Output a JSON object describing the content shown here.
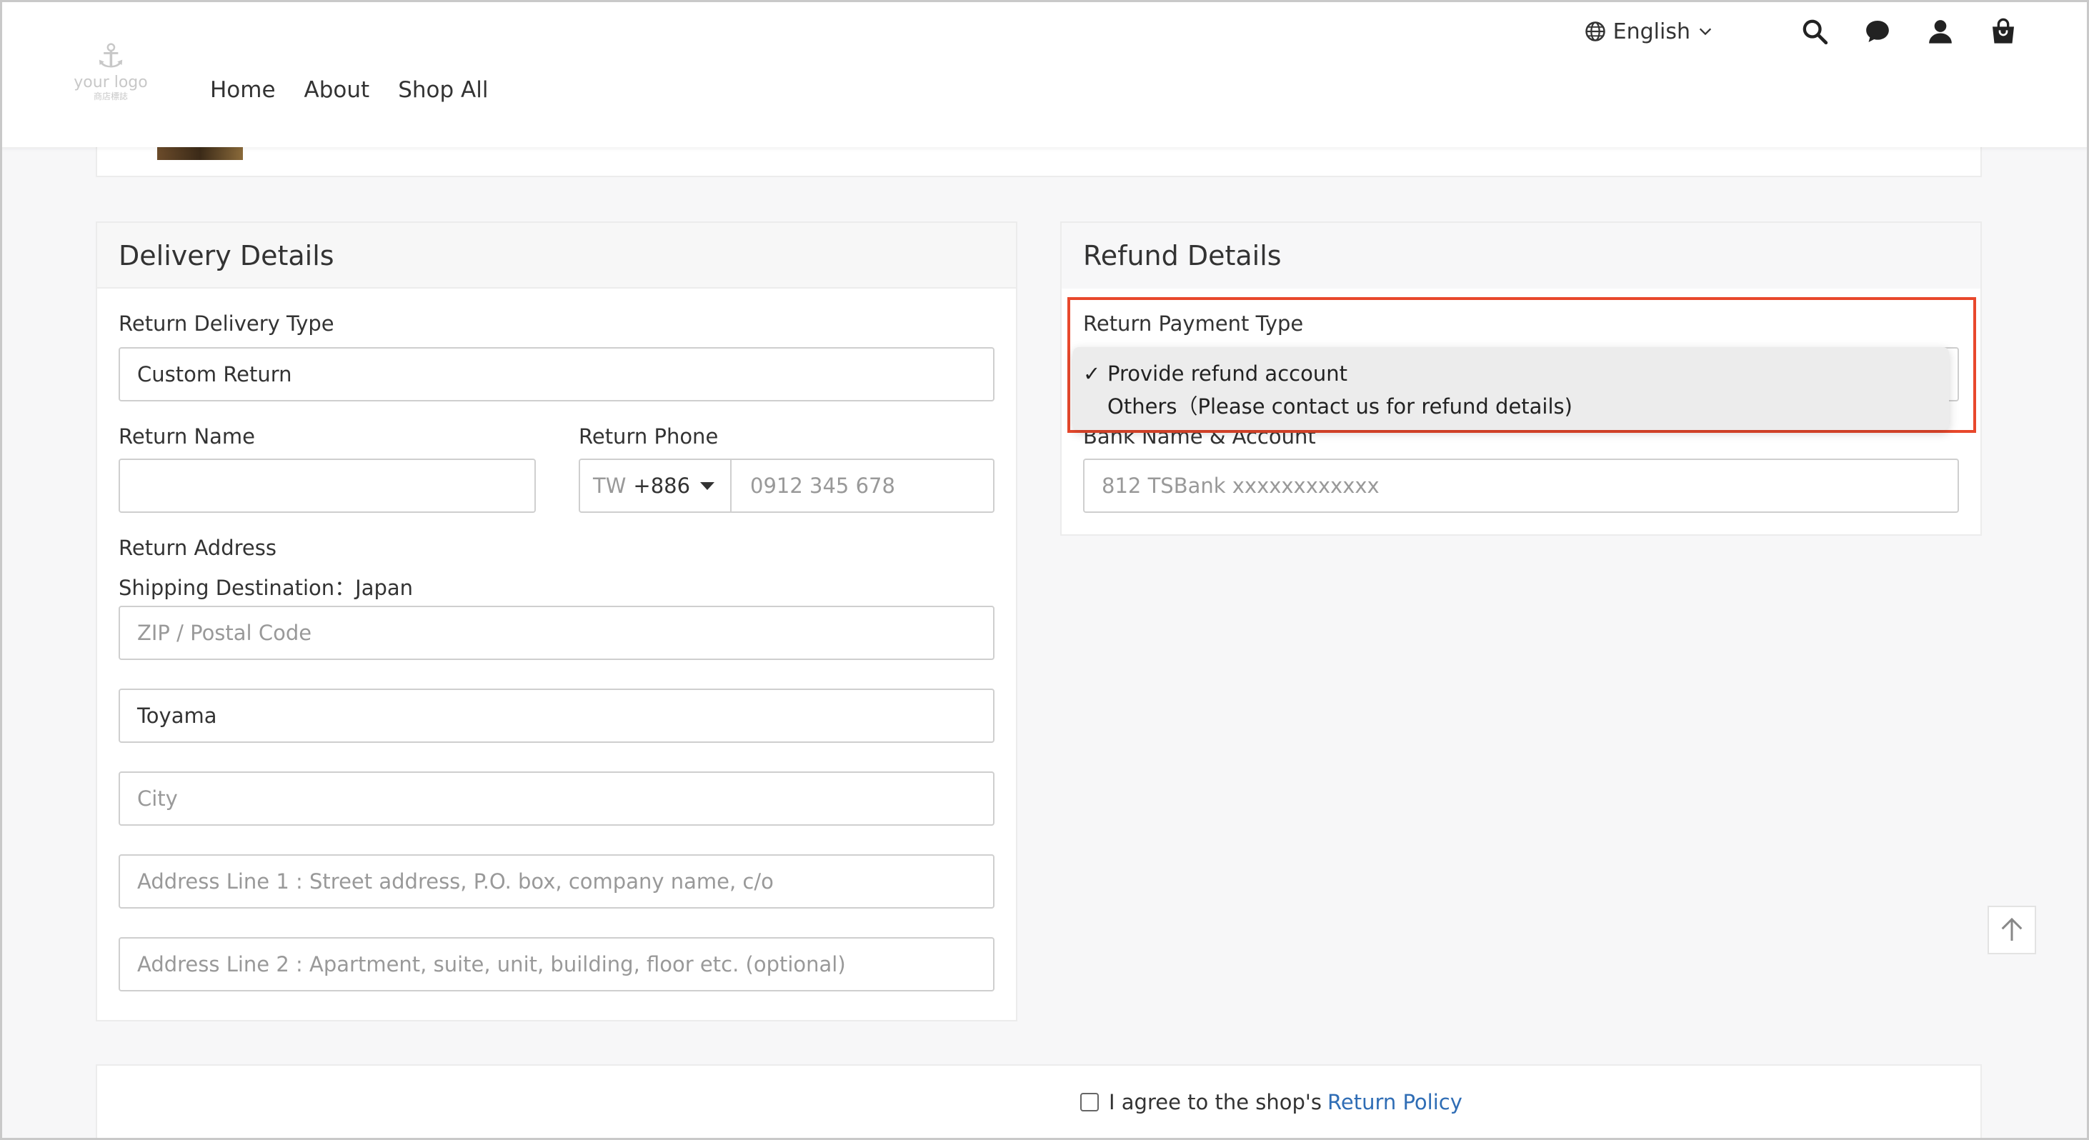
{
  "header": {
    "logo_text": "your logo",
    "logo_sub": "商店標誌",
    "nav": [
      "Home",
      "About",
      "Shop All"
    ],
    "language": "English"
  },
  "delivery": {
    "title": "Delivery Details",
    "return_delivery_type_label": "Return Delivery Type",
    "return_delivery_type_value": "Custom Return",
    "return_name_label": "Return Name",
    "return_name_value": "",
    "return_phone_label": "Return Phone",
    "phone_country": "TW",
    "phone_code": "+886",
    "phone_placeholder": "0912 345 678",
    "return_address_label": "Return Address",
    "shipping_destination": "Shipping Destination：Japan",
    "zip_placeholder": "ZIP / Postal Code",
    "prefecture_value": "Toyama",
    "city_placeholder": "City",
    "address1_placeholder": "Address Line 1 : Street address, P.O. box, company name, c/o",
    "address2_placeholder": "Address Line 2 : Apartment, suite, unit, building, floor etc. (optional)"
  },
  "refund": {
    "title": "Refund Details",
    "payment_type_label": "Return Payment Type",
    "options": [
      {
        "label": "Provide refund account",
        "selected": true
      },
      {
        "label": "Others（Please contact us for refund details)",
        "selected": false
      }
    ],
    "check_mark": "✓",
    "bank_label": "Bank Name & Account",
    "bank_placeholder": "812 TSBank xxxxxxxxxxxx"
  },
  "footer": {
    "agree_text": "I agree to the shop's",
    "policy_link": "Return Policy"
  },
  "colors": {
    "highlight": "#e8482c",
    "link": "#2f6db5"
  }
}
